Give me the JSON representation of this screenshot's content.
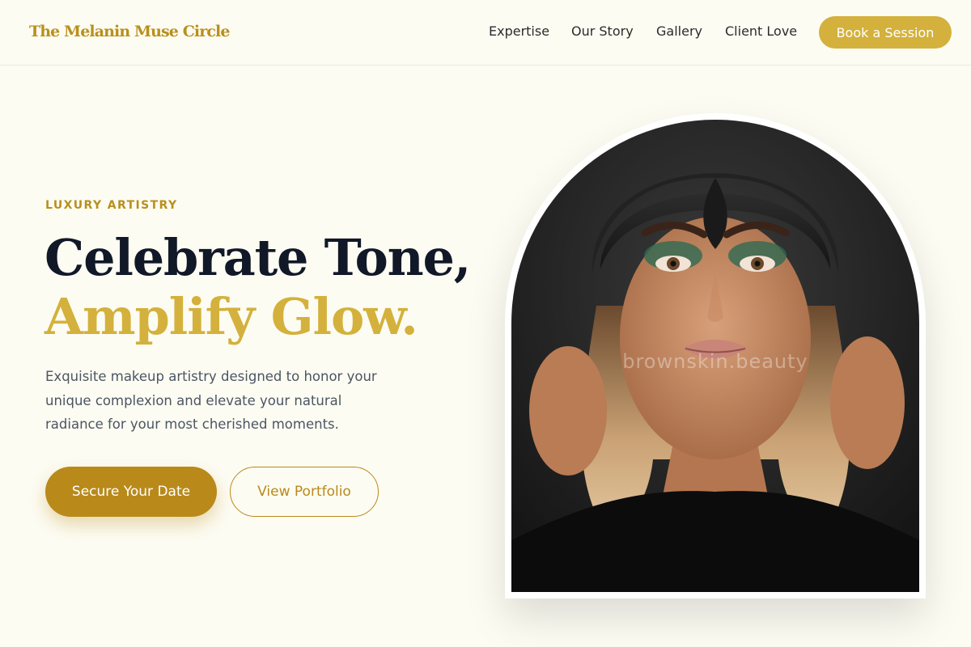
{
  "brand": {
    "name": "The Melanin Muse Circle"
  },
  "nav": {
    "items": [
      "Expertise",
      "Our Story",
      "Gallery",
      "Client Love"
    ],
    "cta": "Book a Session"
  },
  "hero": {
    "eyebrow": "LUXURY ARTISTRY",
    "headline_line1": "Celebrate Tone,",
    "headline_line2": "Amplify Glow.",
    "description": "Exquisite makeup artistry designed to honor your unique complexion and elevate your natural radiance for your most cherished moments.",
    "primary_button": "Secure Your Date",
    "secondary_button": "View Portfolio",
    "image_watermark": "brownskin.beauty"
  },
  "colors": {
    "background": "#fdfcf3",
    "gold": "#d3b13c",
    "gold_dark": "#b9891a",
    "heading": "#111827"
  }
}
